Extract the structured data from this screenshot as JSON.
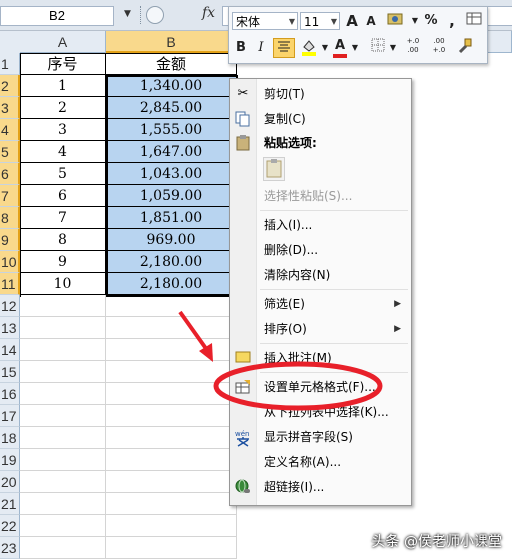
{
  "formula_bar": {
    "name_box": "B2",
    "fx": "fx"
  },
  "columns": [
    "A",
    "B"
  ],
  "row_numbers": [
    "1",
    "2",
    "3",
    "4",
    "5",
    "6",
    "7",
    "8",
    "9",
    "10",
    "11",
    "12",
    "13",
    "14",
    "15",
    "16",
    "17",
    "18",
    "19",
    "20",
    "21",
    "22",
    "23"
  ],
  "table": {
    "headers": [
      "序号",
      "金额"
    ],
    "rows": [
      [
        "1",
        "1,340.00"
      ],
      [
        "2",
        "2,845.00"
      ],
      [
        "3",
        "1,555.00"
      ],
      [
        "4",
        "1,647.00"
      ],
      [
        "5",
        "1,043.00"
      ],
      [
        "6",
        "1,059.00"
      ],
      [
        "7",
        "1,851.00"
      ],
      [
        "8",
        "969.00"
      ],
      [
        "9",
        "2,180.00"
      ],
      [
        "10",
        "2,180.00"
      ]
    ]
  },
  "mini_toolbar": {
    "font_name": "宋体",
    "font_size": "11",
    "grow_font": "A",
    "shrink_font": "A",
    "percent": "%",
    "comma": ",",
    "bold": "B",
    "italic": "I",
    "font_color": "A",
    "increase_decimal": "+.0 .00",
    "decrease_decimal": ".00 +.0"
  },
  "context_menu": {
    "cut": "剪切(T)",
    "copy": "复制(C)",
    "paste_options": "粘贴选项:",
    "paste_special": "选择性粘贴(S)...",
    "insert": "插入(I)...",
    "delete": "删除(D)...",
    "clear_contents": "清除内容(N)",
    "filter": "筛选(E)",
    "sort": "排序(O)",
    "insert_comment": "插入批注(M)",
    "format_cells": "设置单元格格式(F)...",
    "pick_from_list": "从下拉列表中选择(K)...",
    "phonetic": "显示拼音字段(S)",
    "define_name": "定义名称(A)...",
    "hyperlink": "超链接(I)..."
  },
  "watermark": "头条 @侯老师小课堂",
  "colors": {
    "selection": "#b8d4f0",
    "highlight_header": "#f9d98c",
    "annotation": "#e8202a"
  }
}
